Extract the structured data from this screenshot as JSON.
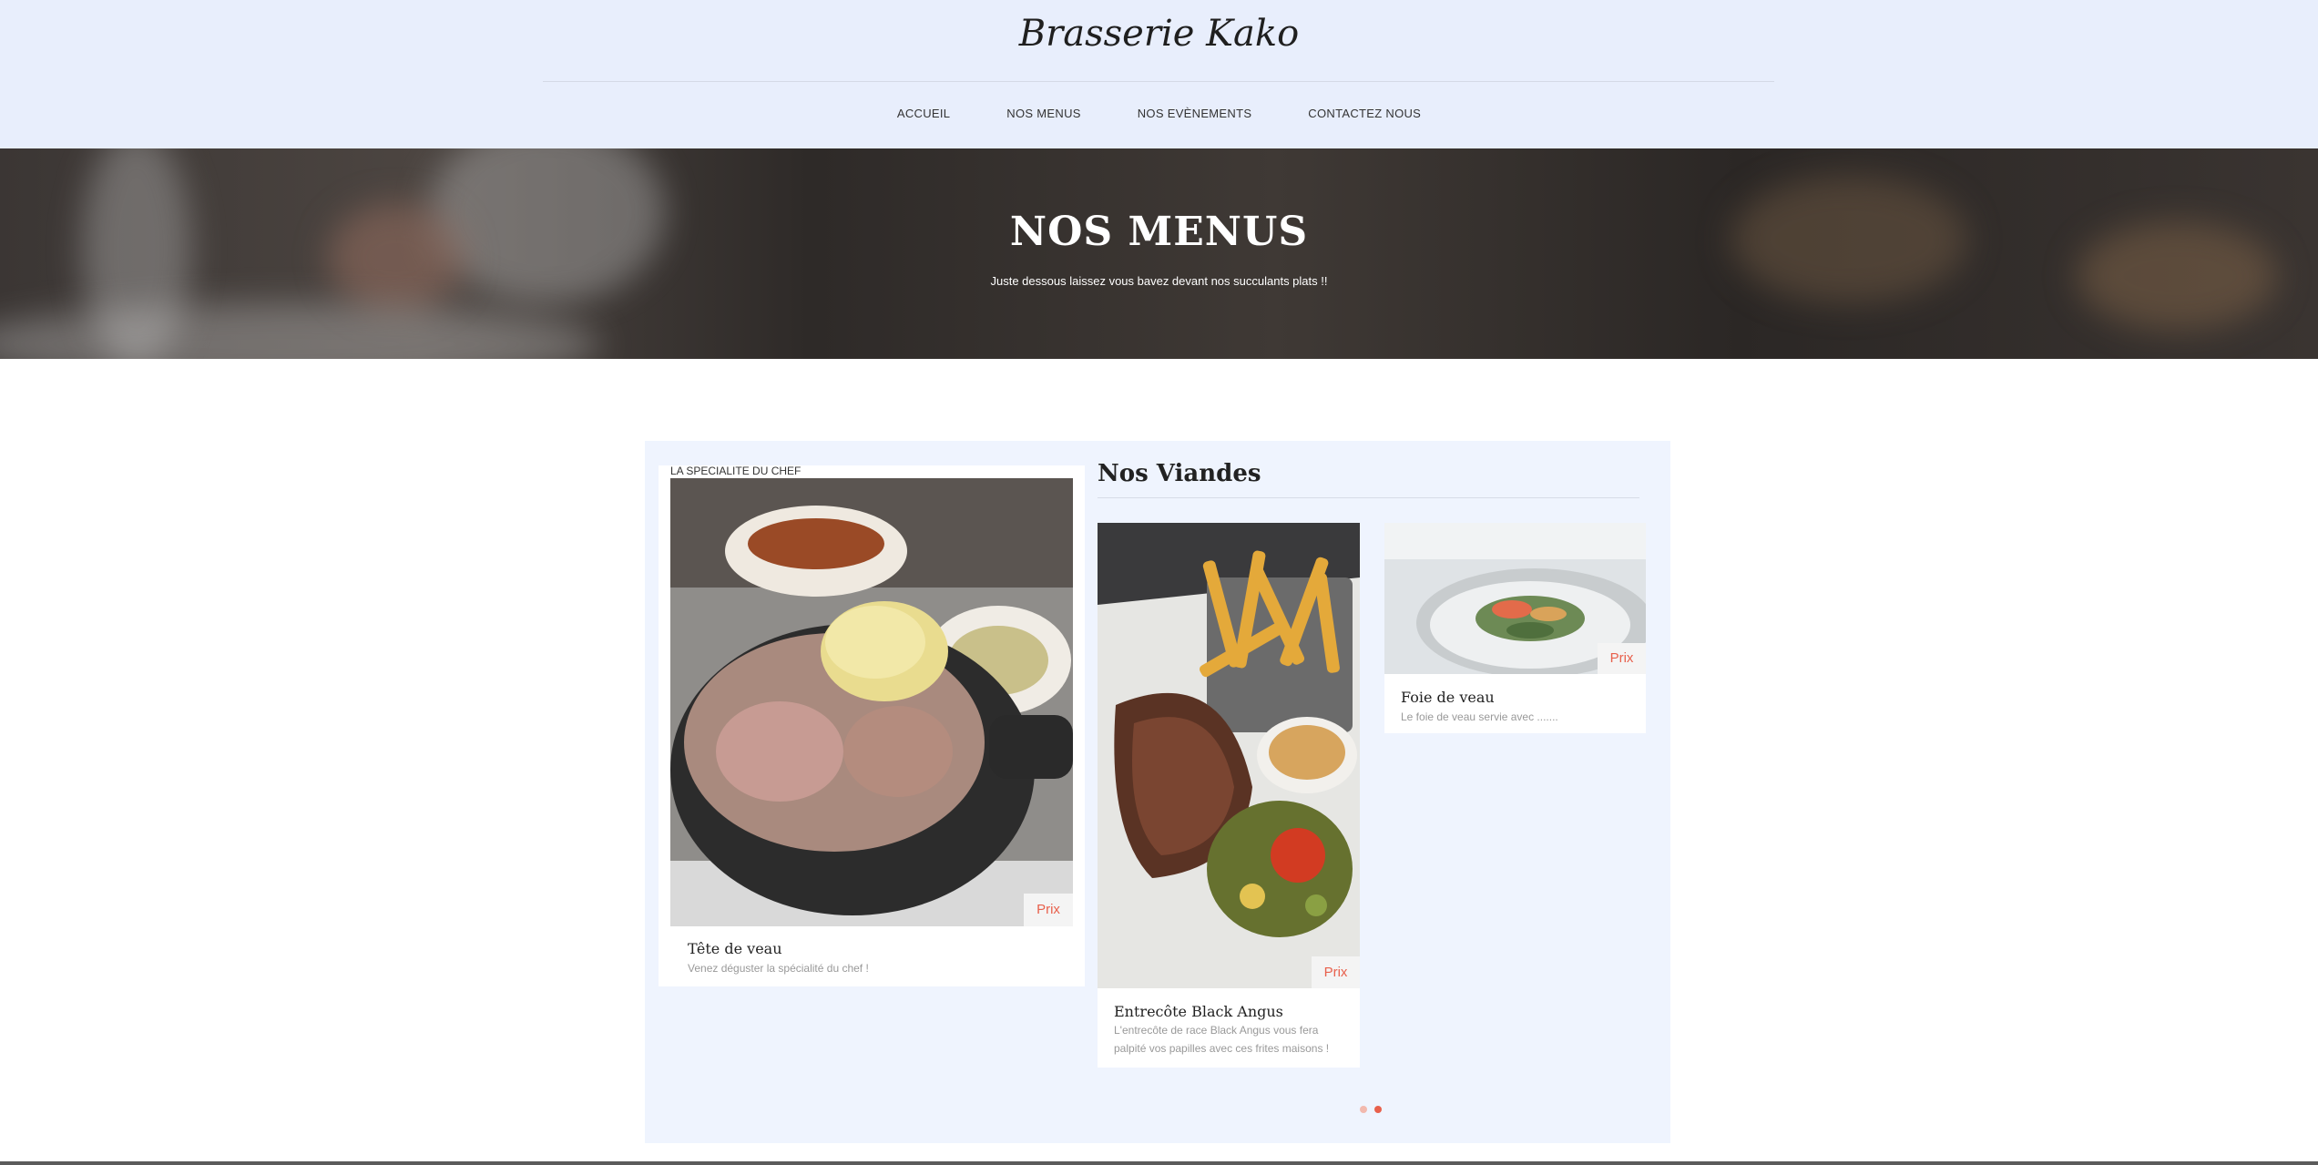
{
  "brand": "Brasserie Kako",
  "nav": [
    "ACCUEIL",
    "NOS MENUS",
    "NOS EVÈNEMENTS",
    "CONTACTEZ NOUS"
  ],
  "hero": {
    "title": "NOS MENUS",
    "subtitle": "Juste dessous laissez vous bavez devant nos succulants plats !!"
  },
  "chef": {
    "tag": "LA SPECIALITE DU CHEF",
    "dish": "Tête de veau",
    "description": "Venez déguster la spécialité du chef !",
    "price_label": "Prix"
  },
  "section": {
    "title": "Nos Viandes"
  },
  "dishes": [
    {
      "name": "Entrecôte Black Angus",
      "description": "L'entrecôte de race Black Angus vous fera palpité vos papilles avec ces frites maisons !",
      "price_label": "Prix"
    },
    {
      "name": "Foie de veau",
      "description": "Le foie de veau servie avec .......",
      "price_label": "Prix"
    }
  ],
  "carousel": {
    "total": 2,
    "active": 2
  },
  "colors": {
    "header_bg": "#e8eefc",
    "panel_bg": "#eff4fe",
    "accent": "#e8604c"
  }
}
